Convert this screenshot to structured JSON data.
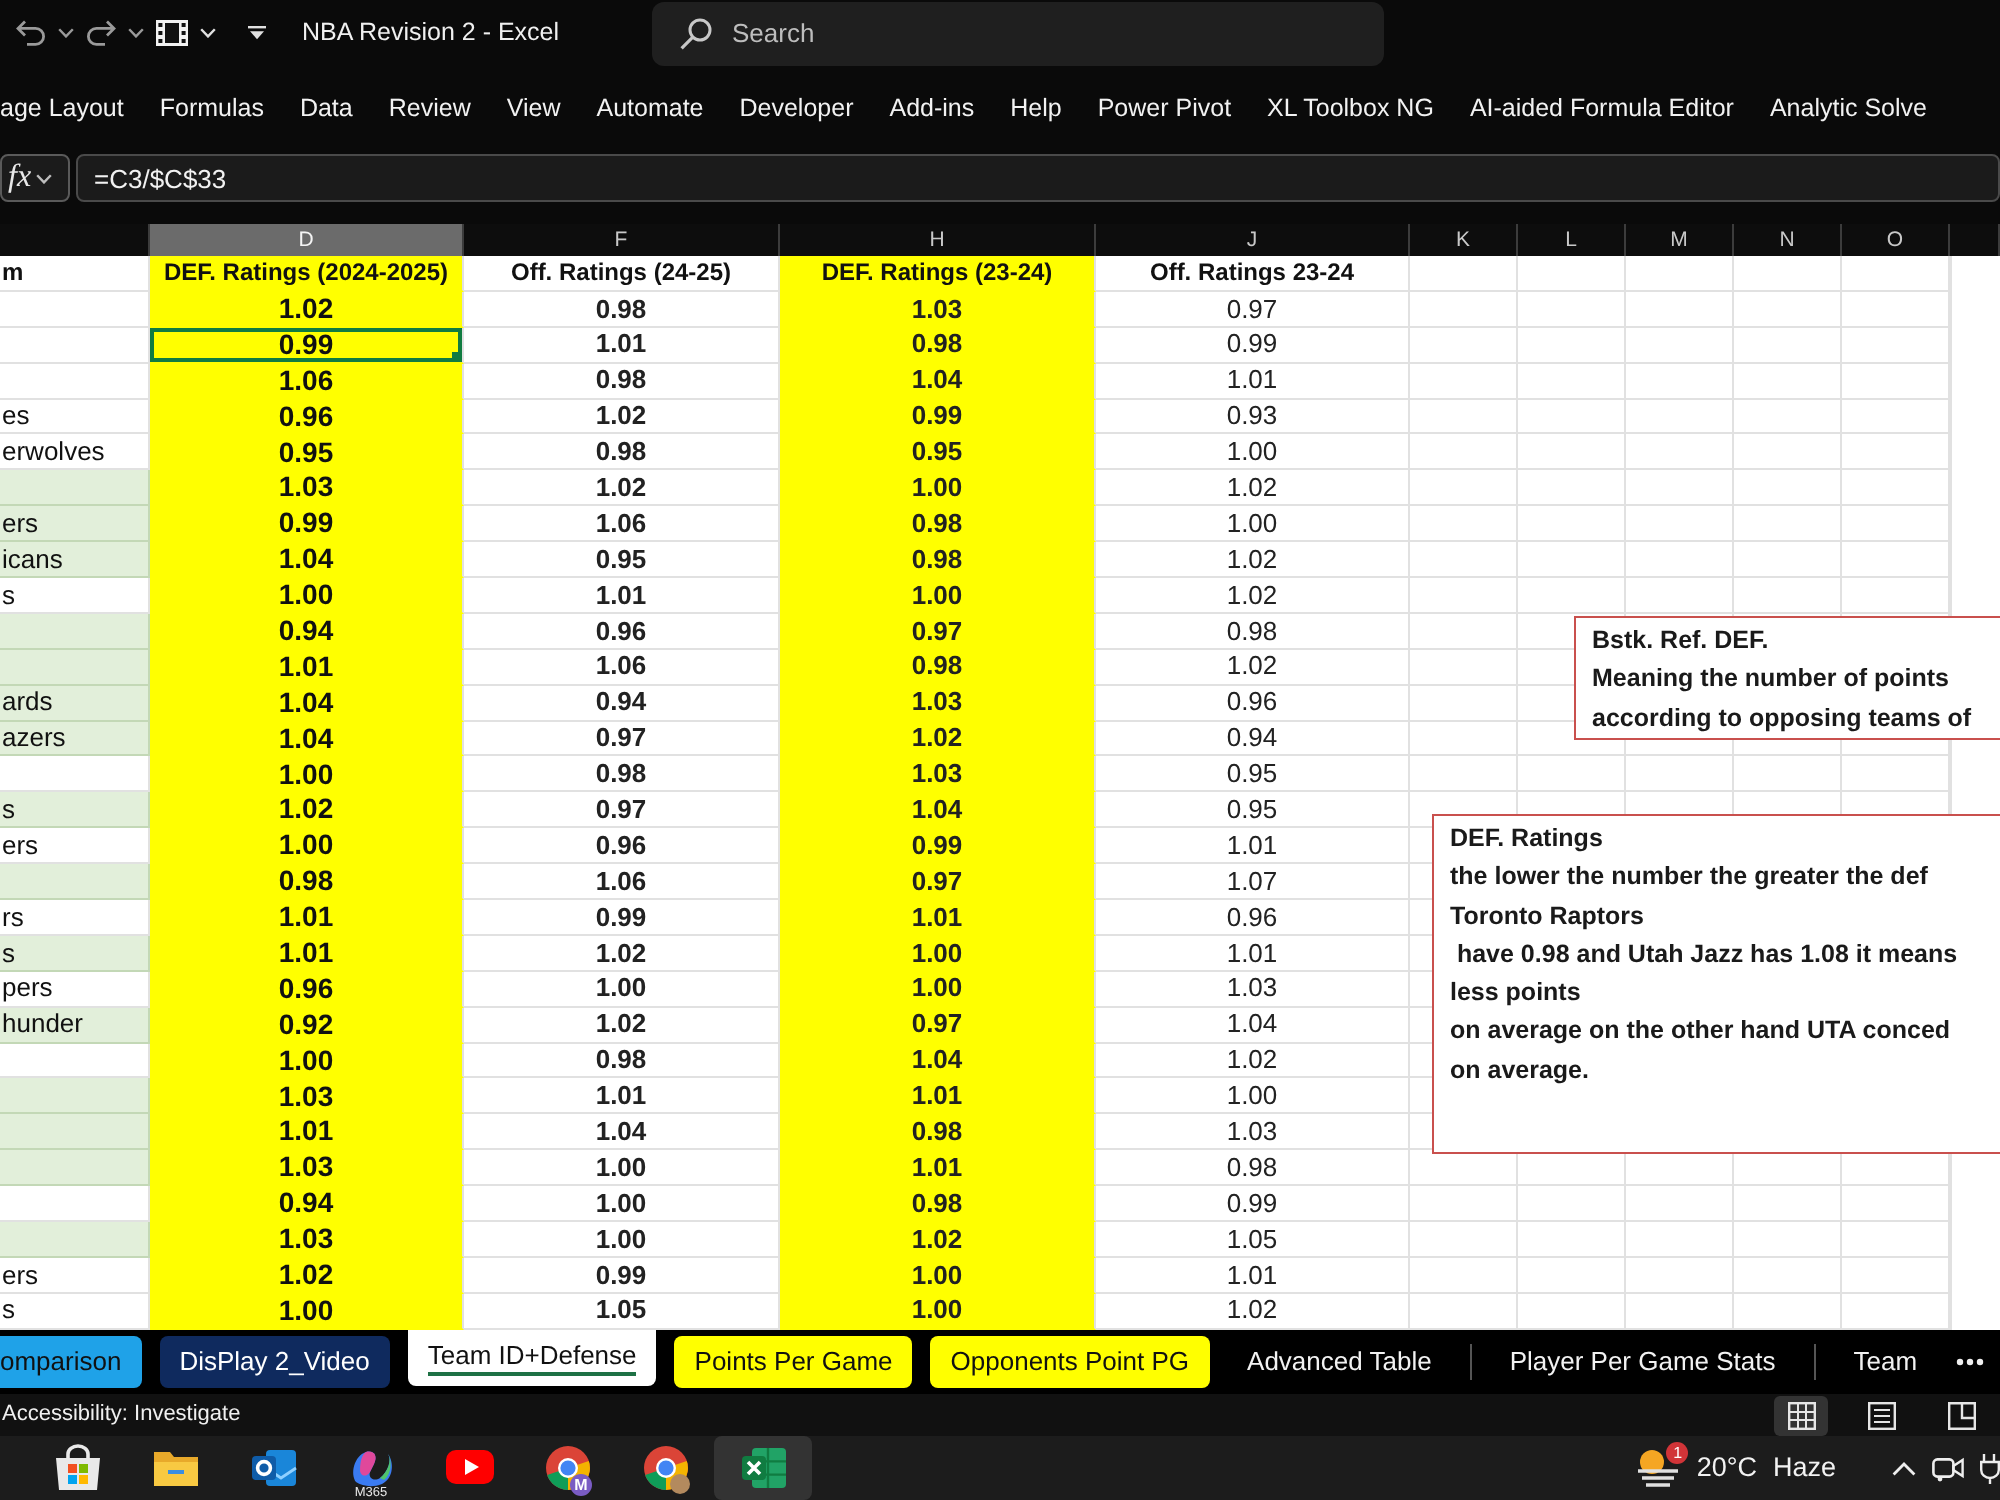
{
  "title_bar": {
    "title": "NBA Revision 2 - Excel",
    "search": {
      "placeholder": "Search"
    }
  },
  "ribbon_tabs": [
    {
      "label": "age Layout",
      "selected": false
    },
    {
      "label": "Formulas",
      "selected": false
    },
    {
      "label": "Data",
      "selected": false
    },
    {
      "label": "Review",
      "selected": false
    },
    {
      "label": "View",
      "selected": false
    },
    {
      "label": "Automate",
      "selected": false
    },
    {
      "label": "Developer",
      "selected": false
    },
    {
      "label": "Add-ins",
      "selected": false
    },
    {
      "label": "Help",
      "selected": false
    },
    {
      "label": "Power Pivot",
      "selected": false
    },
    {
      "label": "XL Toolbox NG",
      "selected": false
    },
    {
      "label": "AI-aided Formula Editor",
      "selected": false
    },
    {
      "label": "Analytic Solve",
      "selected": false
    }
  ],
  "formula_bar": {
    "function_button": "fx",
    "formula": "=C3/$C$33"
  },
  "sheet": {
    "team_column": {
      "heading": "m"
    },
    "columns": [
      {
        "letter": "D",
        "heading": "DEF. Ratings (2024-2025)",
        "selected": true,
        "color": "#ffff00",
        "kind": "large"
      },
      {
        "letter": "F",
        "heading": "Off. Ratings (24-25)",
        "selected": false,
        "kind": "bold"
      },
      {
        "letter": "H",
        "heading": "DEF. Ratings (23-24)",
        "selected": false,
        "color": "#ffff00",
        "kind": "bold"
      },
      {
        "letter": "J",
        "heading": "Off. Ratings 23-24",
        "selected": false,
        "kind": "plain"
      }
    ],
    "empty_columns": [
      "K",
      "L",
      "M",
      "N",
      "O"
    ],
    "rows": [
      {
        "shaded": false,
        "selected": false,
        "values": [
          "1.02",
          "0.98",
          "1.03",
          "0.97"
        ]
      },
      {
        "shaded": false,
        "selected": true,
        "values": [
          "0.99",
          "1.01",
          "0.98",
          "0.99"
        ]
      },
      {
        "shaded": false,
        "selected": false,
        "values": [
          "1.06",
          "0.98",
          "1.04",
          "1.01"
        ]
      },
      {
        "team": "es",
        "shaded": false,
        "selected": false,
        "values": [
          "0.96",
          "1.02",
          "0.99",
          "0.93"
        ]
      },
      {
        "team": "erwolves",
        "shaded": false,
        "selected": false,
        "values": [
          "0.95",
          "0.98",
          "0.95",
          "1.00"
        ]
      },
      {
        "shaded": true,
        "selected": false,
        "values": [
          "1.03",
          "1.02",
          "1.00",
          "1.02"
        ]
      },
      {
        "team": "ers",
        "shaded": true,
        "selected": false,
        "values": [
          "0.99",
          "1.06",
          "0.98",
          "1.00"
        ]
      },
      {
        "team": "icans",
        "shaded": true,
        "selected": false,
        "values": [
          "1.04",
          "0.95",
          "0.98",
          "1.02"
        ]
      },
      {
        "team": "s",
        "shaded": false,
        "selected": false,
        "values": [
          "1.00",
          "1.01",
          "1.00",
          "1.02"
        ]
      },
      {
        "shaded": true,
        "selected": false,
        "values": [
          "0.94",
          "0.96",
          "0.97",
          "0.98"
        ]
      },
      {
        "shaded": true,
        "selected": false,
        "values": [
          "1.01",
          "1.06",
          "0.98",
          "1.02"
        ]
      },
      {
        "team": "ards",
        "shaded": true,
        "selected": false,
        "values": [
          "1.04",
          "0.94",
          "1.03",
          "0.96"
        ]
      },
      {
        "team": "azers",
        "shaded": true,
        "selected": false,
        "values": [
          "1.04",
          "0.97",
          "1.02",
          "0.94"
        ]
      },
      {
        "shaded": false,
        "selected": false,
        "values": [
          "1.00",
          "0.98",
          "1.03",
          "0.95"
        ]
      },
      {
        "team": "s",
        "shaded": true,
        "selected": false,
        "values": [
          "1.02",
          "0.97",
          "1.04",
          "0.95"
        ]
      },
      {
        "team": "ers",
        "shaded": false,
        "selected": false,
        "values": [
          "1.00",
          "0.96",
          "0.99",
          "1.01"
        ]
      },
      {
        "shaded": true,
        "selected": false,
        "values": [
          "0.98",
          "1.06",
          "0.97",
          "1.07"
        ]
      },
      {
        "team": "rs",
        "shaded": false,
        "selected": false,
        "values": [
          "1.01",
          "0.99",
          "1.01",
          "0.96"
        ]
      },
      {
        "team": "s",
        "shaded": true,
        "selected": false,
        "values": [
          "1.01",
          "1.02",
          "1.00",
          "1.01"
        ]
      },
      {
        "team": "pers",
        "shaded": false,
        "selected": false,
        "values": [
          "0.96",
          "1.00",
          "1.00",
          "1.03"
        ]
      },
      {
        "team": "hunder",
        "shaded": true,
        "selected": false,
        "values": [
          "0.92",
          "1.02",
          "0.97",
          "1.04"
        ]
      },
      {
        "shaded": false,
        "selected": false,
        "values": [
          "1.00",
          "0.98",
          "1.04",
          "1.02"
        ]
      },
      {
        "shaded": true,
        "selected": false,
        "values": [
          "1.03",
          "1.01",
          "1.01",
          "1.00"
        ]
      },
      {
        "shaded": true,
        "selected": false,
        "values": [
          "1.01",
          "1.04",
          "0.98",
          "1.03"
        ]
      },
      {
        "shaded": true,
        "selected": false,
        "values": [
          "1.03",
          "1.00",
          "1.01",
          "0.98"
        ]
      },
      {
        "shaded": false,
        "selected": false,
        "values": [
          "0.94",
          "1.00",
          "0.98",
          "0.99"
        ]
      },
      {
        "shaded": true,
        "selected": false,
        "values": [
          "1.03",
          "1.00",
          "1.02",
          "1.05"
        ]
      },
      {
        "team": "ers",
        "shaded": false,
        "selected": false,
        "values": [
          "1.02",
          "0.99",
          "1.00",
          "1.01"
        ]
      },
      {
        "team": "s",
        "shaded": false,
        "selected": false,
        "values": [
          "1.00",
          "1.05",
          "1.00",
          "1.02"
        ]
      }
    ]
  },
  "text_boxes": [
    {
      "lines": [
        "Bstk. Ref. DEF.",
        "Meaning the number of points",
        "according to opposing teams of"
      ]
    },
    {
      "lines": [
        "DEF. Ratings",
        "the lower the number the greater the def",
        "Toronto Raptors",
        " have 0.98 and Utah Jazz has 1.08 it means",
        "less points",
        "on average on the other hand UTA conced",
        "on average."
      ]
    }
  ],
  "sheet_tabs": [
    {
      "label": "omparison",
      "selected": false,
      "color": "#1fa2e8"
    },
    {
      "label": "DisPlay 2_Video",
      "selected": false,
      "color": "#0f2a5e"
    },
    {
      "label": "Team ID+Defense",
      "selected": true
    },
    {
      "label": "Points Per Game",
      "selected": false,
      "color": "#ffff00"
    },
    {
      "label": "Opponents Point PG",
      "selected": false,
      "color": "#ffff00"
    },
    {
      "label": "Advanced Table",
      "selected": false
    },
    {
      "label": "Player Per Game Stats",
      "selected": false
    },
    {
      "label": "Team",
      "selected": false
    }
  ],
  "status_bar": {
    "text": "Accessibility: Investigate",
    "views": [
      {
        "kind": "normal",
        "selected": true
      },
      {
        "kind": "layout",
        "selected": false
      },
      {
        "kind": "breaks",
        "selected": false
      }
    ]
  },
  "taskbar": {
    "apps": [
      {
        "kind": "store",
        "selected": false
      },
      {
        "kind": "folder",
        "selected": false
      },
      {
        "kind": "mail",
        "selected": false
      },
      {
        "kind": "swirl",
        "caption": "M365",
        "selected": false
      },
      {
        "kind": "video",
        "selected": false
      },
      {
        "kind": "browser",
        "badge": "M",
        "selected": false
      },
      {
        "kind": "browser",
        "avatar": true,
        "selected": false
      },
      {
        "kind": "spreadsheet",
        "selected": true
      }
    ],
    "weather": {
      "badge": "1",
      "temperature": "20°C",
      "condition": "Haze"
    }
  }
}
